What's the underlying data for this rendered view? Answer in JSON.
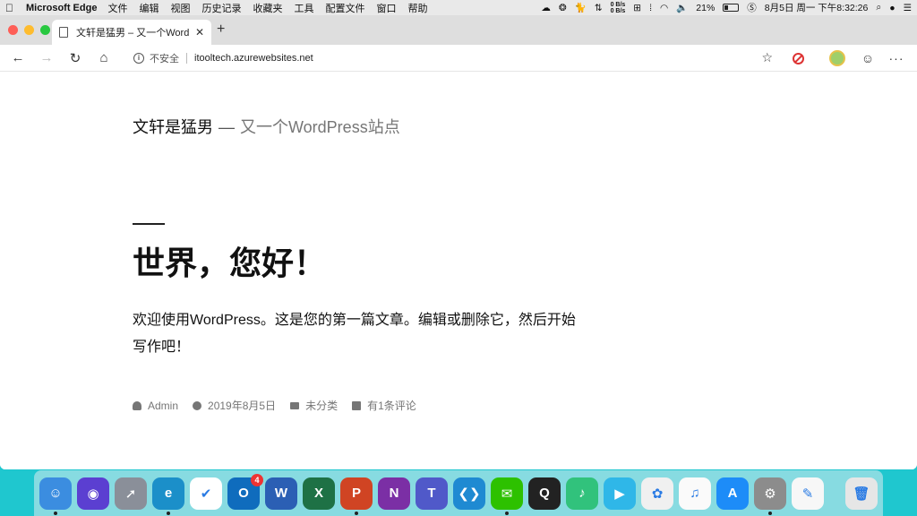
{
  "menubar": {
    "app_name": "Microsoft Edge",
    "items": [
      "文件",
      "编辑",
      "视图",
      "历史记录",
      "收藏夹",
      "工具",
      "配置文件",
      "窗口",
      "帮助"
    ],
    "net_up": "0 B/s",
    "net_down": "0 B/s",
    "battery": "21%",
    "clock": "8月5日 周一 下午8:32:26"
  },
  "browser": {
    "tab_title": "文轩是猛男 – 又一个WordPress站点",
    "address_security": "不安全",
    "address_url": "itooltech.azurewebsites.net"
  },
  "page": {
    "site_title": "文轩是猛男",
    "site_separator": "—",
    "site_description": "又一个WordPress站点",
    "post_title": "世界，您好！",
    "post_body": "欢迎使用WordPress。这是您的第一篇文章。编辑或删除它，然后开始写作吧！",
    "meta": {
      "author": "Admin",
      "date": "2019年8月5日",
      "category": "未分类",
      "comments": "有1条评论"
    }
  },
  "dock": {
    "apps": [
      {
        "name": "Finder",
        "color": "#3b8de0",
        "letter": "☺",
        "running": true
      },
      {
        "name": "Siri",
        "color": "#5b3fd1",
        "letter": "◉",
        "running": false
      },
      {
        "name": "Launchpad",
        "color": "#8a8f99",
        "letter": "➚",
        "running": false
      },
      {
        "name": "Edge Dev",
        "color": "#1b8fc9",
        "letter": "e",
        "running": true
      },
      {
        "name": "Tasks",
        "color": "#ffffff",
        "letter": "✔",
        "running": false
      },
      {
        "name": "Outlook",
        "color": "#0f6cbd",
        "letter": "O",
        "badge": "4",
        "running": false
      },
      {
        "name": "Word",
        "color": "#2b5fb4",
        "letter": "W",
        "running": false
      },
      {
        "name": "Excel",
        "color": "#1e7145",
        "letter": "X",
        "running": false
      },
      {
        "name": "PowerPoint",
        "color": "#d04423",
        "letter": "P",
        "running": true
      },
      {
        "name": "OneNote",
        "color": "#7b2fa5",
        "letter": "N",
        "running": false
      },
      {
        "name": "Teams",
        "color": "#5059c9",
        "letter": "T",
        "running": false
      },
      {
        "name": "VS Code",
        "color": "#1f8ad2",
        "letter": "❮❯",
        "running": false
      },
      {
        "name": "WeChat",
        "color": "#2dc100",
        "letter": "✉",
        "running": true
      },
      {
        "name": "QQ",
        "color": "#222222",
        "letter": "Q",
        "running": false
      },
      {
        "name": "QQ Music",
        "color": "#31c27c",
        "letter": "♪",
        "running": false
      },
      {
        "name": "Tencent Video",
        "color": "#2fb7e8",
        "letter": "▶",
        "running": false
      },
      {
        "name": "Photos",
        "color": "#f0f0f0",
        "letter": "✿",
        "running": false
      },
      {
        "name": "iTunes",
        "color": "#fafafa",
        "letter": "♫",
        "running": false
      },
      {
        "name": "App Store",
        "color": "#1d8cf8",
        "letter": "A",
        "running": false
      },
      {
        "name": "System Preferences",
        "color": "#8c8c8c",
        "letter": "⚙",
        "running": true
      },
      {
        "name": "TextEdit",
        "color": "#f7f7f7",
        "letter": "✎",
        "running": false
      }
    ],
    "trash": {
      "name": "Trash",
      "color": "#e6e6e6",
      "letter": "🗑"
    }
  }
}
